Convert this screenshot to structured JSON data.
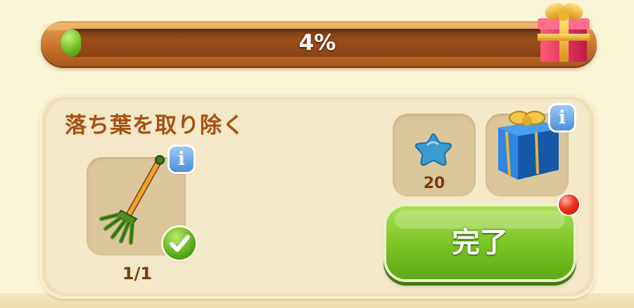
{
  "progress": {
    "percent_text": "4%",
    "fraction": 0.04,
    "fill_color": "#6fbf25"
  },
  "task": {
    "title": "落ち葉を取り除く",
    "item_icon": "rake-icon",
    "count": "1/1",
    "completed": true
  },
  "rewards": [
    {
      "icon": "blue-star-icon",
      "value": "20"
    },
    {
      "icon": "blue-gift-box-icon",
      "value": ""
    }
  ],
  "complete_button": {
    "label": "完了",
    "color": "#79c324"
  },
  "info_label": "i",
  "colors": {
    "title": "#a84f12",
    "notification": "#f2321f"
  }
}
